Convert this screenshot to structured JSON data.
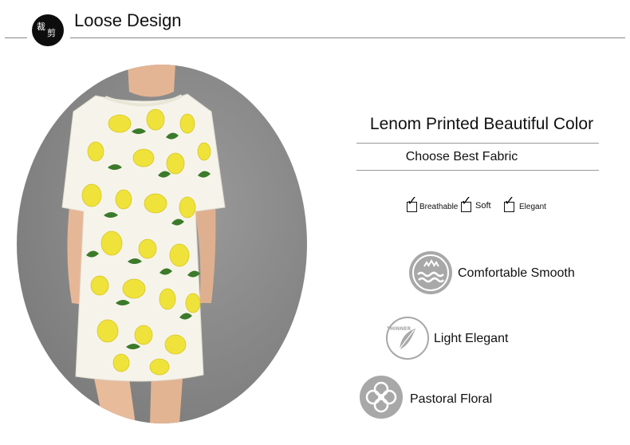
{
  "header": {
    "badge_char_1": "裁",
    "badge_char_2": "剪",
    "title": "Loose Design"
  },
  "product": {
    "headline": "Lenom Printed Beautiful Color",
    "subline": "Choose Best Fabric",
    "checks": [
      {
        "label": "Breathable",
        "checked": true
      },
      {
        "label": "Soft",
        "checked": true
      },
      {
        "label": "Elegant",
        "checked": true
      }
    ],
    "features": [
      {
        "label": "Comfortable Smooth",
        "icon": "comfort-waves-icon"
      },
      {
        "label": "Light Elegant",
        "icon": "feather-icon",
        "icon_text": "THINNER"
      },
      {
        "label": "Pastoral Floral",
        "icon": "flower-icon"
      }
    ]
  },
  "colors": {
    "badge": "#0d0d0d",
    "icon_gray": "#a8a8a8",
    "photo_background": "#8e8e8e",
    "dress_white": "#f6f4ea",
    "lemon_yellow": "#efe23a",
    "leaf_green": "#3b7a2a"
  }
}
